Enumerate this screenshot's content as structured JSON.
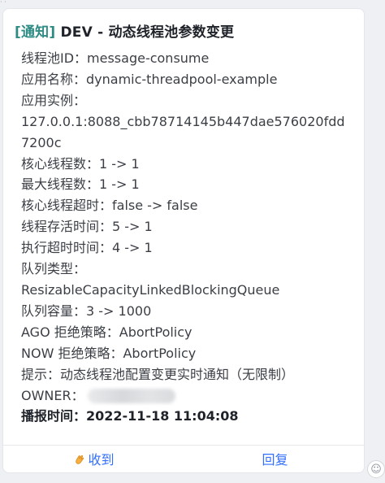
{
  "notice": {
    "tag": "[通知]",
    "title": "DEV - 动态线程池参数变更"
  },
  "lines": [
    "线程池ID：message-consume",
    "应用名称：dynamic-threadpool-example",
    "应用实例：",
    "127.0.0.1:8088_cbb78714145b447dae576020fdd",
    "7200c",
    "核心线程数：1 -> 1",
    "最大线程数：1 -> 1",
    "核心线程超时：false -> false",
    "线程存活时间：5 -> 1",
    "执行超时时间：4 -> 1",
    "队列类型：",
    "ResizableCapacityLinkedBlockingQueue",
    "队列容量：3 -> 1000",
    "AGO 拒绝策略：AbortPolicy",
    "NOW 拒绝策略：AbortPolicy",
    "提示：动态线程池配置变更实时通知（无限制）"
  ],
  "owner_label": "OWNER：",
  "broadcast_time": "播报时间：2022-11-18 11:04:08",
  "actions": {
    "received_icon": "clapping-hands-icon",
    "received": "收到",
    "reply": "回复"
  },
  "colors": {
    "tag": "#2e8c85",
    "action": "#3370ff"
  }
}
